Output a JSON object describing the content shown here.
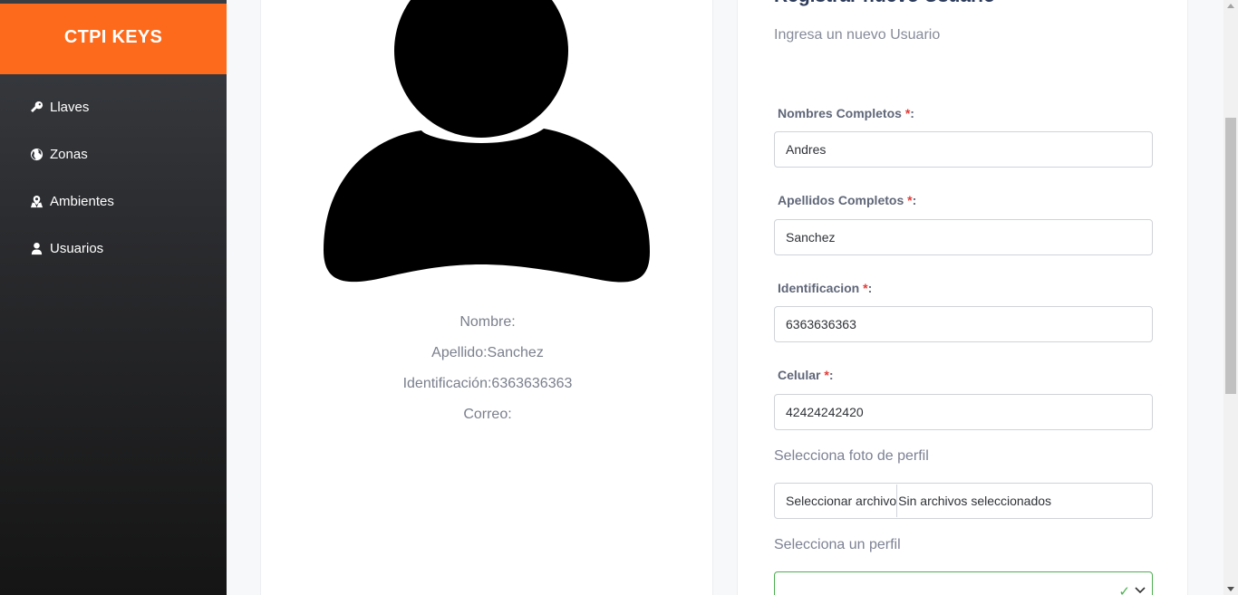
{
  "sidebar": {
    "brand": "CTPI KEYS",
    "items": [
      {
        "label": "Llaves",
        "icon": "key-icon"
      },
      {
        "label": "Zonas",
        "icon": "globe-icon"
      },
      {
        "label": "Ambientes",
        "icon": "map-location-icon"
      },
      {
        "label": "Usuarios",
        "icon": "user-icon"
      }
    ]
  },
  "profile": {
    "nombre_label": "Nombre:",
    "apellido_label": "Apellido:Sanchez",
    "identificacion_label": "Identificación:6363636363",
    "correo_label": "Correo:"
  },
  "form": {
    "title": "Registrar nuevo Usuario",
    "subtitle": "Ingresa un nuevo Usuario",
    "nombres": {
      "label": "Nombres Completos",
      "required": "*",
      "colon": ":",
      "value": "Andres"
    },
    "apellidos": {
      "label": "Apellidos Completos",
      "required": "*",
      "colon": ":",
      "value": "Sanchez"
    },
    "identificacion": {
      "label": "Identificacion",
      "required": "*",
      "colon": ":",
      "value": "6363636363"
    },
    "celular": {
      "label": "Celular",
      "required": "*",
      "colon": ":",
      "value": "42424242420"
    },
    "foto": {
      "label": "Selecciona foto de perfil",
      "button": "Seleccionar archivo",
      "status": "Sin archivos seleccionados"
    },
    "perfil": {
      "label": "Selecciona un perfil",
      "value": ""
    }
  },
  "colors": {
    "brand": "#fd6a1b",
    "sidebar_top": "#3a3d42",
    "sidebar_bottom": "#151515",
    "valid": "#4caf50",
    "required": "#e53935"
  }
}
